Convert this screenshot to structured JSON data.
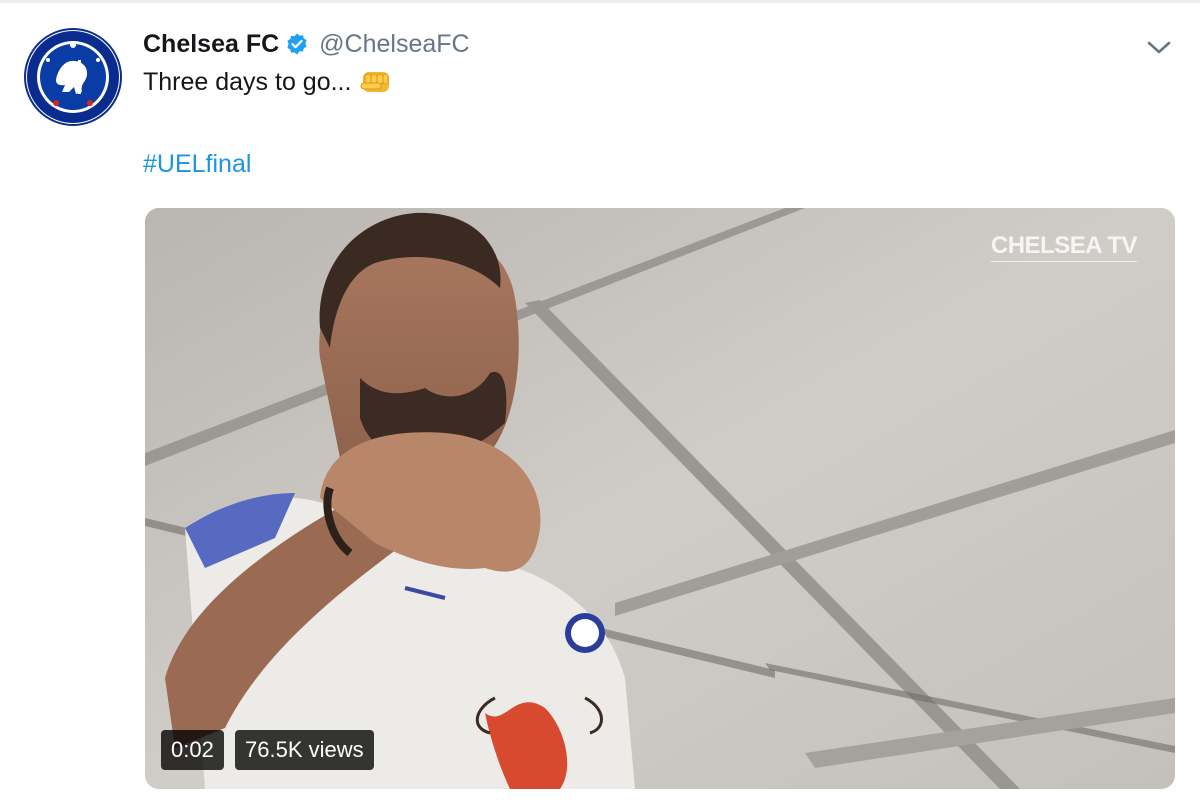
{
  "tweet": {
    "display_name": "Chelsea FC",
    "handle": "@ChelseaFC",
    "text": "Three days to go...",
    "hashtag": "#UELfinal",
    "verified": true
  },
  "icons": {
    "avatar": "chelsea-crest-icon",
    "verified": "verified-badge-icon",
    "caret": "chevron-down-icon",
    "emoji": "oncoming-fist-emoji"
  },
  "media": {
    "watermark": "CHELSEA TV",
    "duration": "0:02",
    "views": "76.5K views"
  },
  "colors": {
    "text": "#14171a",
    "secondary": "#657786",
    "link": "#1b95e0",
    "verified": "#1da1f2",
    "club_blue": "#034694"
  }
}
